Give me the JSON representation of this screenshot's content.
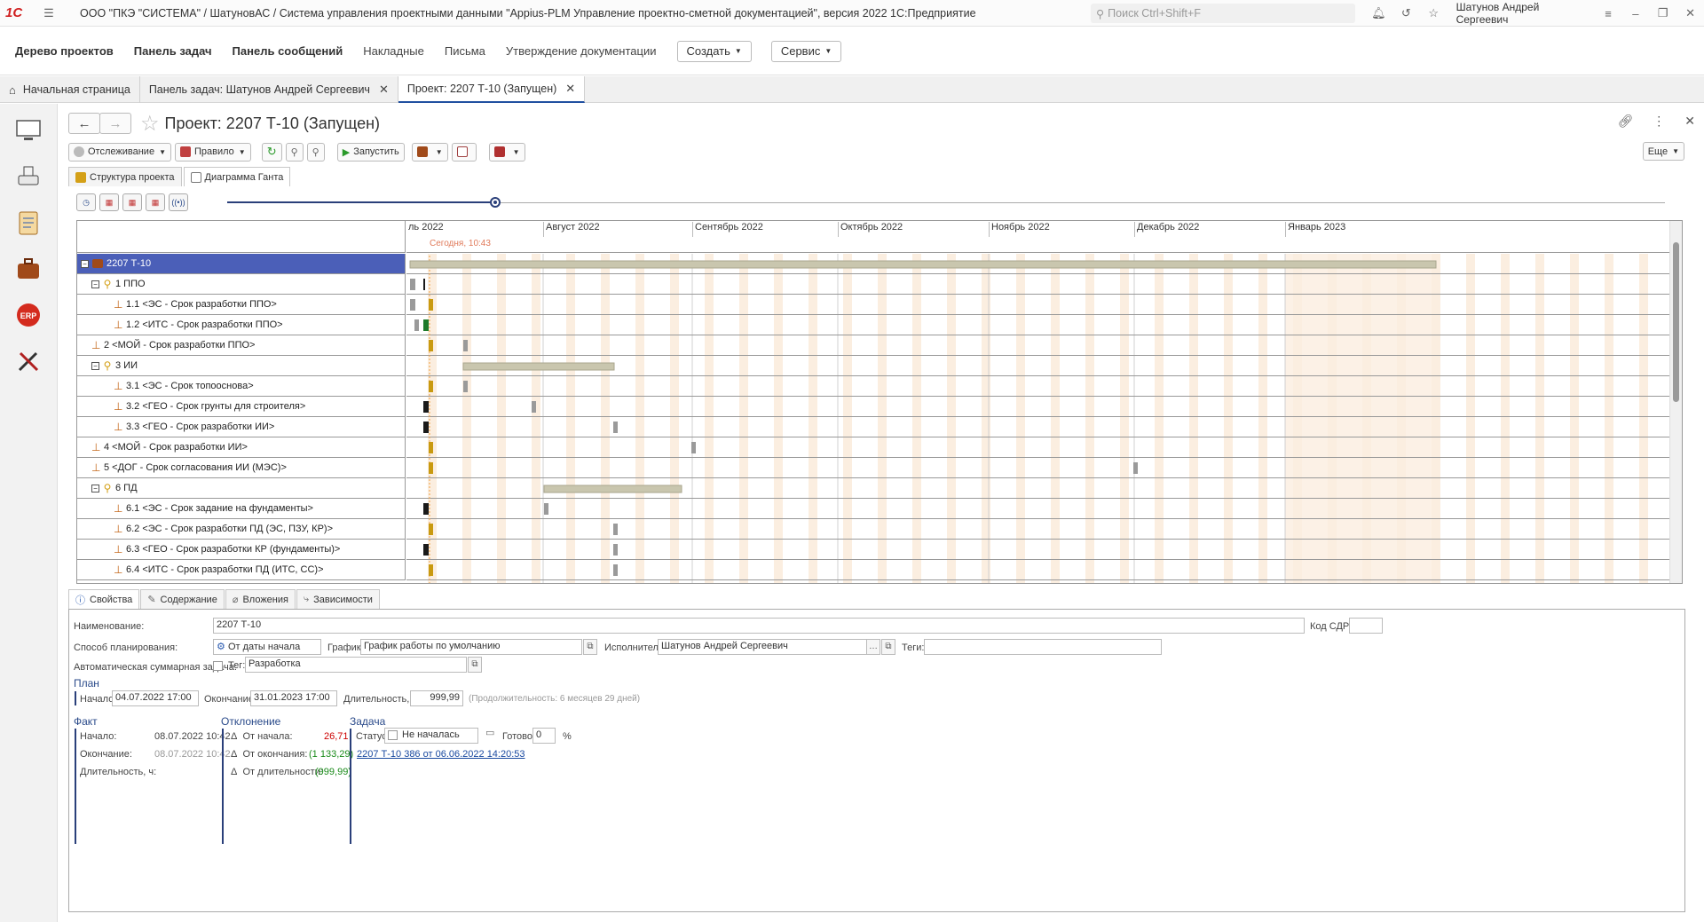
{
  "titlebar": {
    "logo": "1С",
    "title": "ООО \"ПКЭ \"СИСТЕМА\" / ШатуновАС / Система управления проектными данными \"Appius-PLM Управление проектно-сметной документацией\", версия 2022 1С:Предприятие",
    "search_placeholder": "Поиск Ctrl+Shift+F",
    "user": "Шатунов Андрей Сергеевич"
  },
  "menu": {
    "items": [
      "Дерево проектов",
      "Панель задач",
      "Панель сообщений",
      "Накладные",
      "Письма",
      "Утверждение документации"
    ],
    "create": "Создать",
    "service": "Сервис"
  },
  "open_tabs": [
    "Начальная страница",
    "Панель задач: Шатунов Андрей Сергеевич",
    "Проект: 2207 Т-10 (Запущен)"
  ],
  "form": {
    "title": "Проект: 2207 Т-10 (Запущен)",
    "toolbar": {
      "tracking": "Отслеживание",
      "rule": "Правило",
      "start": "Запустить",
      "more": "Еще"
    },
    "inner_tabs": [
      "Структура проекта",
      "Диаграмма Ганта"
    ]
  },
  "gantt": {
    "months": [
      "ль 2022",
      "Август 2022",
      "Сентябрь 2022",
      "Октябрь 2022",
      "Ноябрь 2022",
      "Декабрь 2022",
      "Январь 2023"
    ],
    "today": "Сегодня, 10:43",
    "rows": [
      {
        "name": "2207 Т-10",
        "level": 0,
        "group": true
      },
      {
        "name": "1 ППО",
        "level": 1,
        "group": true
      },
      {
        "name": "1.1 <ЭС - Срок разработки ППО>",
        "level": 2
      },
      {
        "name": "1.2 <ИТС - Срок разработки ППО>",
        "level": 2
      },
      {
        "name": "2 <МОЙ - Срок разработки ППО>",
        "level": 1
      },
      {
        "name": "3 ИИ",
        "level": 1,
        "group": true
      },
      {
        "name": "3.1 <ЭС - Срок топооснова>",
        "level": 2
      },
      {
        "name": "3.2 <ГЕО - Срок грунты для строителя>",
        "level": 2
      },
      {
        "name": "3.3 <ГЕО - Срок разработки ИИ>",
        "level": 2
      },
      {
        "name": "4 <МОЙ - Срок разработки ИИ>",
        "level": 1
      },
      {
        "name": "5 <ДОГ - Срок согласования ИИ (МЭС)>",
        "level": 1
      },
      {
        "name": "6 ПД",
        "level": 1,
        "group": true
      },
      {
        "name": "6.1 <ЭС - Срок задание на фундаменты>",
        "level": 2
      },
      {
        "name": "6.2 <ЭС - Срок разработки ПД (ЭС, ПЗУ, КР)>",
        "level": 2
      },
      {
        "name": "6.3 <ГЕО - Срок разработки КР (фундаменты)>",
        "level": 2
      },
      {
        "name": "6.4 <ИТС - Срок разработки ПД (ИТС, СС)>",
        "level": 2
      }
    ]
  },
  "props": {
    "tabs": [
      "Свойства",
      "Содержание",
      "Вложения",
      "Зависимости"
    ],
    "name_label": "Наименование:",
    "name_value": "2207 Т-10",
    "sdr_label": "Код СДР:",
    "plan_method_label": "Способ планирования:",
    "plan_method_value": "От даты начала",
    "schedule_label": "График:",
    "schedule_value": "График работы по умолчанию",
    "executor_label": "Исполнитель:",
    "executor_value": "Шатунов Андрей Сергеевич",
    "tags_label": "Теги:",
    "auto_sum_label": "Автоматическая суммарная задача:",
    "tag_label": "Тег:",
    "tag_value": "Разработка",
    "plan_title": "План",
    "start_label": "Начало:",
    "start_value": "04.07.2022 17:00",
    "end_label": "Окончание:",
    "end_value": "31.01.2023 17:00",
    "duration_label": "Длительность, ч:",
    "duration_value": "999,99",
    "duration_note": "(Продолжительность: 6 месяцев 29 дней)",
    "fact_title": "Факт",
    "fact_start_label": "Начало:",
    "fact_start_value": "08.07.2022 10:42",
    "fact_end_label": "Окончание:",
    "fact_end_value": "08.07.2022 10:42",
    "fact_dur_label": "Длительность, ч:",
    "dev_title": "Отклонение",
    "dev_start_label": "От начала:",
    "dev_start_value": "26,71",
    "dev_end_label": "От окончания:",
    "dev_end_value": "(1 133,29)",
    "dev_dur_label": "От длительности:",
    "dev_dur_value": "(999,99)",
    "task_title": "Задача",
    "status_label": "Статус:",
    "status_value": "Не началась",
    "ready_label": "Готово:",
    "ready_value": "0",
    "pct": "%",
    "task_link": "2207 Т-10 386 от 06.06.2022 14:20:53"
  }
}
